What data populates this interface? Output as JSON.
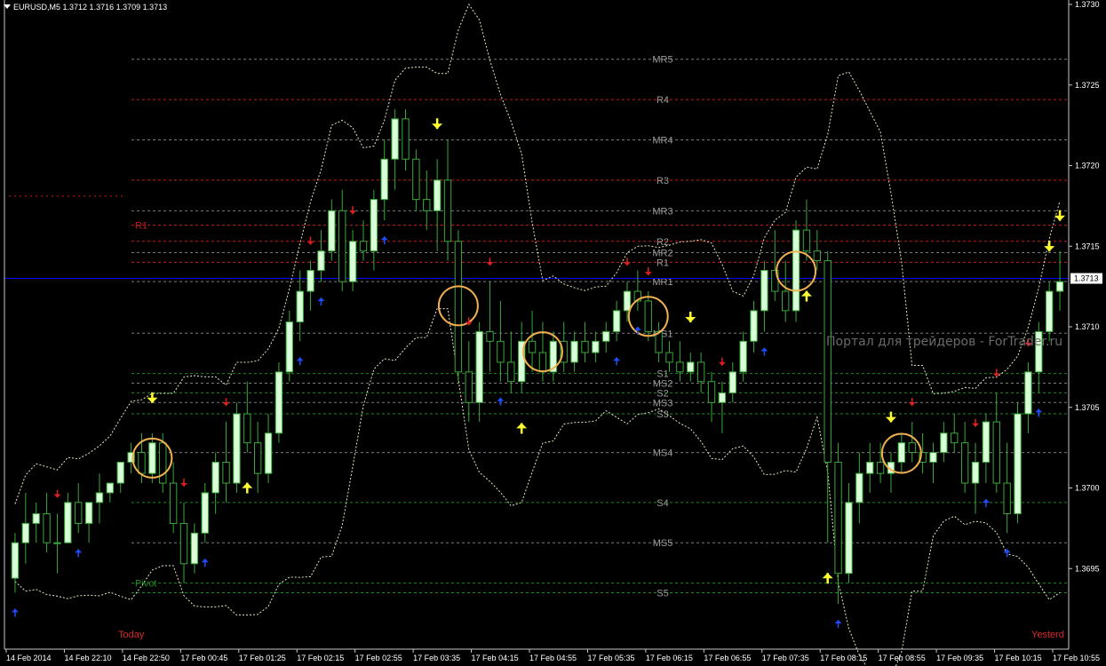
{
  "header": {
    "symbol": "EURUSD,M5",
    "ohlc": "1.3712 1.3716 1.3709 1.3713"
  },
  "watermark": "Портал для трейдеров - ForTrader.ru",
  "session_labels": {
    "today": "Today",
    "yesterday": "Yesterd"
  },
  "colors": {
    "background": "#000000",
    "candle_bull": "#d8ffd8",
    "candle_wick": "#3aa83a",
    "current_price_line": "#0000ff",
    "resistance_line": "#c81e1e",
    "support_line": "#1e8c1e",
    "mid_line": "#7a7a7a",
    "bands": "#e8e8c0",
    "arrow_up_blue": "#1f4dff",
    "arrow_down_red": "#e02020",
    "arrow_yellow": "#ffff33",
    "circle": "#f0b050"
  },
  "chart_data": {
    "type": "candlestick",
    "symbol": "EURUSD",
    "timeframe": "M5",
    "ylim": [
      1.369,
      1.373
    ],
    "current_price": "1.3713",
    "y_ticks": [
      "1.3730",
      "1.3725",
      "1.3720",
      "1.3715",
      "1.3710",
      "1.3705",
      "1.3700",
      "1.3695"
    ],
    "x_ticks": [
      "14 Feb 2014",
      "14 Feb 22:10",
      "14 Feb 22:50",
      "17 Feb 00:45",
      "17 Feb 01:25",
      "17 Feb 02:15",
      "17 Feb 02:55",
      "17 Feb 03:35",
      "17 Feb 04:15",
      "17 Feb 04:55",
      "17 Feb 05:35",
      "17 Feb 06:15",
      "17 Feb 06:55",
      "17 Feb 07:35",
      "17 Feb 08:15",
      "17 Feb 08:55",
      "17 Feb 09:35",
      "17 Feb 10:15",
      "17 Feb 10:55"
    ],
    "levels": [
      {
        "label": "MR5",
        "price": 1.37266,
        "kind": "mid"
      },
      {
        "label": "R4",
        "price": 1.37241,
        "kind": "res"
      },
      {
        "label": "MR4",
        "price": 1.37216,
        "kind": "mid"
      },
      {
        "label": "R3",
        "price": 1.37191,
        "kind": "res"
      },
      {
        "label": "MR3",
        "price": 1.37172,
        "kind": "mid"
      },
      {
        "label": "R2",
        "price": 1.37153,
        "kind": "res"
      },
      {
        "label": "MR2",
        "price": 1.37146,
        "kind": "mid"
      },
      {
        "label": "R1",
        "price": 1.3714,
        "kind": "res"
      },
      {
        "label": "MR1",
        "price": 1.37128,
        "kind": "mid"
      },
      {
        "label": "MS1",
        "price": 1.37096,
        "kind": "mid"
      },
      {
        "label": "S1",
        "price": 1.37071,
        "kind": "sup"
      },
      {
        "label": "MS2",
        "price": 1.37065,
        "kind": "mid"
      },
      {
        "label": "S2",
        "price": 1.37059,
        "kind": "sup"
      },
      {
        "label": "MS3",
        "price": 1.37053,
        "kind": "mid"
      },
      {
        "label": "S3",
        "price": 1.37046,
        "kind": "sup"
      },
      {
        "label": "MS4",
        "price": 1.37022,
        "kind": "mid"
      },
      {
        "label": "S4",
        "price": 1.36991,
        "kind": "sup"
      },
      {
        "label": "MS5",
        "price": 1.36966,
        "kind": "mid"
      },
      {
        "label": "Pivot",
        "price": 1.36941,
        "kind": "pivot"
      },
      {
        "label": "S5",
        "price": 1.36935,
        "kind": "sup"
      }
    ],
    "yesterday_levels": [
      {
        "label": "R1",
        "price": 1.37163,
        "kind": "res"
      }
    ],
    "candles": [
      [
        1.36944,
        1.36972,
        1.36935,
        1.36966
      ],
      [
        1.36966,
        1.36997,
        1.36953,
        1.36978
      ],
      [
        1.36978,
        1.36991,
        1.36966,
        1.36984
      ],
      [
        1.36984,
        1.36997,
        1.3696,
        1.36966
      ],
      [
        1.36966,
        1.36984,
        1.36947,
        1.36966
      ],
      [
        1.36966,
        1.36997,
        1.36966,
        1.36991
      ],
      [
        1.36991,
        1.37003,
        1.36972,
        1.36978
      ],
      [
        1.36978,
        1.36991,
        1.36966,
        1.36991
      ],
      [
        1.36991,
        1.37009,
        1.36978,
        1.36997
      ],
      [
        1.36997,
        1.37003,
        1.36991,
        1.37003
      ],
      [
        1.37003,
        1.37016,
        1.36997,
        1.37016
      ],
      [
        1.37016,
        1.37028,
        1.37009,
        1.37022
      ],
      [
        1.37022,
        1.37034,
        1.37003,
        1.37009
      ],
      [
        1.37009,
        1.37034,
        1.37003,
        1.37028
      ],
      [
        1.37028,
        1.37034,
        1.36997,
        1.37003
      ],
      [
        1.37003,
        1.37016,
        1.36972,
        1.36978
      ],
      [
        1.36978,
        1.36991,
        1.36941,
        1.36953
      ],
      [
        1.36953,
        1.36978,
        1.36947,
        1.36972
      ],
      [
        1.36972,
        1.37003,
        1.36966,
        1.36997
      ],
      [
        1.36997,
        1.37022,
        1.36984,
        1.37016
      ],
      [
        1.37016,
        1.37041,
        1.36991,
        1.37003
      ],
      [
        1.37003,
        1.37053,
        1.36997,
        1.37046
      ],
      [
        1.37046,
        1.37066,
        1.37022,
        1.37028
      ],
      [
        1.37028,
        1.37041,
        1.36997,
        1.37009
      ],
      [
        1.37009,
        1.37046,
        1.37003,
        1.37034
      ],
      [
        1.37034,
        1.37078,
        1.37028,
        1.37072
      ],
      [
        1.37072,
        1.3711,
        1.37066,
        1.37103
      ],
      [
        1.37103,
        1.37135,
        1.37091,
        1.37122
      ],
      [
        1.37122,
        1.37141,
        1.3711,
        1.37135
      ],
      [
        1.37135,
        1.3716,
        1.37128,
        1.37147
      ],
      [
        1.37147,
        1.37179,
        1.37141,
        1.37172
      ],
      [
        1.37172,
        1.37185,
        1.37122,
        1.37128
      ],
      [
        1.37128,
        1.3716,
        1.37122,
        1.37153
      ],
      [
        1.37153,
        1.37166,
        1.37141,
        1.37147
      ],
      [
        1.37147,
        1.37185,
        1.37135,
        1.37179
      ],
      [
        1.37179,
        1.37216,
        1.37166,
        1.37204
      ],
      [
        1.37204,
        1.37235,
        1.37185,
        1.37229
      ],
      [
        1.37229,
        1.37235,
        1.37197,
        1.37204
      ],
      [
        1.37204,
        1.3721,
        1.37172,
        1.37179
      ],
      [
        1.37179,
        1.37197,
        1.3716,
        1.37172
      ],
      [
        1.37172,
        1.37204,
        1.37147,
        1.37191
      ],
      [
        1.37191,
        1.37216,
        1.37141,
        1.37153
      ],
      [
        1.37153,
        1.3716,
        1.37066,
        1.37072
      ],
      [
        1.37072,
        1.37091,
        1.37041,
        1.37053
      ],
      [
        1.37053,
        1.37103,
        1.37041,
        1.37097
      ],
      [
        1.37097,
        1.37128,
        1.37072,
        1.37091
      ],
      [
        1.37091,
        1.37116,
        1.37066,
        1.37078
      ],
      [
        1.37078,
        1.37097,
        1.37059,
        1.37066
      ],
      [
        1.37066,
        1.37103,
        1.37059,
        1.37091
      ],
      [
        1.37091,
        1.3711,
        1.37072,
        1.37084
      ],
      [
        1.37084,
        1.37103,
        1.37066,
        1.37072
      ],
      [
        1.37072,
        1.37097,
        1.37066,
        1.37091
      ],
      [
        1.37091,
        1.37103,
        1.37072,
        1.37078
      ],
      [
        1.37078,
        1.37097,
        1.37072,
        1.37091
      ],
      [
        1.37091,
        1.37103,
        1.37078,
        1.37084
      ],
      [
        1.37084,
        1.37097,
        1.37078,
        1.37091
      ],
      [
        1.37091,
        1.37103,
        1.37084,
        1.37097
      ],
      [
        1.37097,
        1.37116,
        1.37091,
        1.3711
      ],
      [
        1.3711,
        1.37128,
        1.37103,
        1.37122
      ],
      [
        1.37122,
        1.37135,
        1.3711,
        1.37116
      ],
      [
        1.37116,
        1.37122,
        1.37091,
        1.37097
      ],
      [
        1.37097,
        1.37103,
        1.37078,
        1.37084
      ],
      [
        1.37084,
        1.37091,
        1.37072,
        1.37078
      ],
      [
        1.37078,
        1.37091,
        1.37066,
        1.37072
      ],
      [
        1.37072,
        1.37084,
        1.37066,
        1.37078
      ],
      [
        1.37078,
        1.37084,
        1.37059,
        1.37066
      ],
      [
        1.37066,
        1.37072,
        1.37041,
        1.37053
      ],
      [
        1.37053,
        1.37066,
        1.37034,
        1.37059
      ],
      [
        1.37059,
        1.37078,
        1.37053,
        1.37072
      ],
      [
        1.37072,
        1.37097,
        1.37066,
        1.37091
      ],
      [
        1.37091,
        1.37116,
        1.37084,
        1.3711
      ],
      [
        1.3711,
        1.37141,
        1.37097,
        1.37135
      ],
      [
        1.37135,
        1.3716,
        1.37116,
        1.37122
      ],
      [
        1.37122,
        1.37141,
        1.37103,
        1.3711
      ],
      [
        1.3711,
        1.37166,
        1.37103,
        1.3716
      ],
      [
        1.3716,
        1.37179,
        1.37141,
        1.37147
      ],
      [
        1.37147,
        1.3716,
        1.37135,
        1.37141
      ],
      [
        1.37141,
        1.37147,
        1.36966,
        1.37016
      ],
      [
        1.37016,
        1.37028,
        1.36928,
        1.36947
      ],
      [
        1.36947,
        1.37003,
        1.36941,
        1.36991
      ],
      [
        1.36991,
        1.37022,
        1.36978,
        1.37009
      ],
      [
        1.37009,
        1.37028,
        1.36997,
        1.37016
      ],
      [
        1.37016,
        1.37028,
        1.37003,
        1.37009
      ],
      [
        1.37009,
        1.37022,
        1.36997,
        1.37016
      ],
      [
        1.37016,
        1.37034,
        1.37009,
        1.37028
      ],
      [
        1.37028,
        1.37041,
        1.37016,
        1.37022
      ],
      [
        1.37022,
        1.37034,
        1.37009,
        1.37016
      ],
      [
        1.37016,
        1.37028,
        1.37003,
        1.37022
      ],
      [
        1.37022,
        1.37041,
        1.37016,
        1.37034
      ],
      [
        1.37034,
        1.37046,
        1.37022,
        1.37028
      ],
      [
        1.37028,
        1.37041,
        1.36997,
        1.37003
      ],
      [
        1.37003,
        1.37028,
        1.36984,
        1.37016
      ],
      [
        1.37016,
        1.37046,
        1.37003,
        1.37041
      ],
      [
        1.37041,
        1.37059,
        1.36997,
        1.37003
      ],
      [
        1.37003,
        1.37028,
        1.36972,
        1.36984
      ],
      [
        1.36984,
        1.37053,
        1.36978,
        1.37046
      ],
      [
        1.37046,
        1.37078,
        1.37034,
        1.37072
      ],
      [
        1.37072,
        1.37103,
        1.37059,
        1.37097
      ],
      [
        1.37097,
        1.37128,
        1.37091,
        1.37122
      ],
      [
        1.37122,
        1.37147,
        1.3711,
        1.37128
      ]
    ],
    "arrows": [
      {
        "kind": "blue-up",
        "i": 0
      },
      {
        "kind": "red-down",
        "i": 4
      },
      {
        "kind": "blue-up",
        "i": 6
      },
      {
        "kind": "yellow-down",
        "i": 13
      },
      {
        "kind": "red-down",
        "i": 16
      },
      {
        "kind": "blue-up",
        "i": 18
      },
      {
        "kind": "yellow-up",
        "i": 22
      },
      {
        "kind": "red-down",
        "i": 20
      },
      {
        "kind": "blue-up",
        "i": 27
      },
      {
        "kind": "red-down",
        "i": 28
      },
      {
        "kind": "blue-up",
        "i": 29
      },
      {
        "kind": "red-down",
        "i": 32
      },
      {
        "kind": "blue-up",
        "i": 35
      },
      {
        "kind": "yellow-down",
        "i": 40
      },
      {
        "kind": "red-down",
        "i": 43
      },
      {
        "kind": "red-down",
        "i": 45
      },
      {
        "kind": "blue-up",
        "i": 46
      },
      {
        "kind": "yellow-up",
        "i": 48
      },
      {
        "kind": "red-down",
        "i": 58
      },
      {
        "kind": "red-down",
        "i": 60
      },
      {
        "kind": "blue-up",
        "i": 57
      },
      {
        "kind": "blue-up",
        "i": 59
      },
      {
        "kind": "yellow-down",
        "i": 64
      },
      {
        "kind": "red-down",
        "i": 67
      },
      {
        "kind": "blue-up",
        "i": 71
      },
      {
        "kind": "yellow-up",
        "i": 75
      },
      {
        "kind": "yellow-up",
        "i": 77
      },
      {
        "kind": "blue-up",
        "i": 78
      },
      {
        "kind": "yellow-down",
        "i": 83
      },
      {
        "kind": "red-down",
        "i": 85
      },
      {
        "kind": "red-down",
        "i": 91
      },
      {
        "kind": "blue-up",
        "i": 92
      },
      {
        "kind": "red-down",
        "i": 93
      },
      {
        "kind": "blue-up",
        "i": 94
      },
      {
        "kind": "red-down",
        "i": 96
      },
      {
        "kind": "blue-up",
        "i": 97
      },
      {
        "kind": "yellow-down",
        "i": 98
      },
      {
        "kind": "yellow-down",
        "i": 99
      }
    ],
    "markers": [
      13,
      42,
      50,
      60,
      74,
      84
    ]
  }
}
